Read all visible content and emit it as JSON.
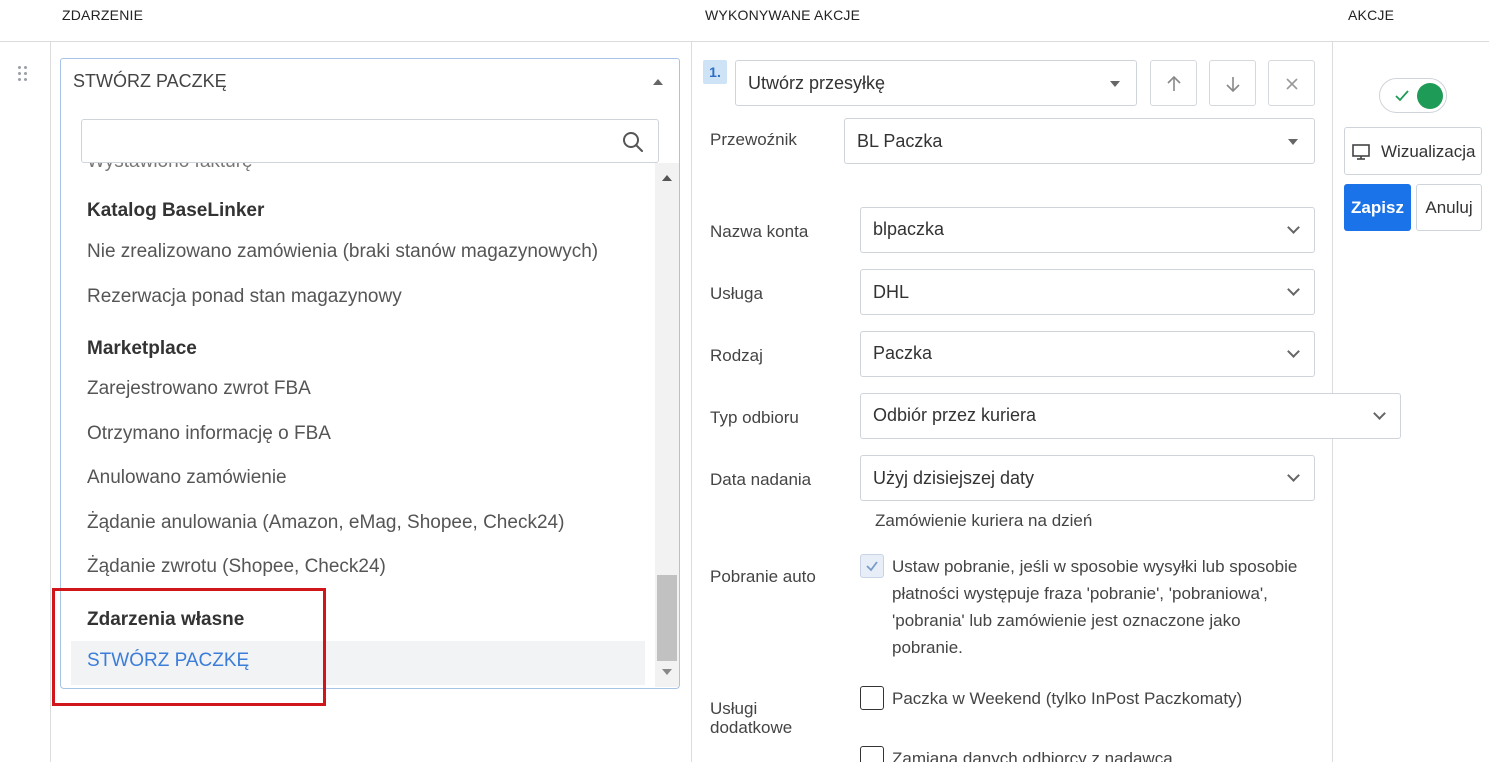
{
  "header": {
    "col_event": "ZDARZENIE",
    "col_actions": "WYKONYWANE AKCJE",
    "col_akcje": "AKCJE"
  },
  "event_select": {
    "value": "STWÓRZ PACZKĘ",
    "search_placeholder": "",
    "cut_item": "Wystawiono fakturę",
    "groups": [
      {
        "label": "Katalog BaseLinker",
        "items": [
          "Nie zrealizowano zamówienia (braki stanów magazynowych)",
          "Rezerwacja ponad stan magazynowy"
        ]
      },
      {
        "label": "Marketplace",
        "items": [
          "Zarejestrowano zwrot FBA",
          "Otrzymano informację o FBA",
          "Anulowano zamówienie",
          "Żądanie anulowania (Amazon, eMag, Shopee, Check24)",
          "Żądanie zwrotu (Shopee, Check24)"
        ]
      },
      {
        "label": "Zdarzenia własne",
        "items": [
          "STWÓRZ PACZKĘ"
        ]
      }
    ]
  },
  "action": {
    "step": "1.",
    "type": "Utwórz przesyłkę",
    "fields": {
      "carrier": {
        "label": "Przewoźnik",
        "value": "BL Paczka"
      },
      "account": {
        "label": "Nazwa konta",
        "value": "blpaczka"
      },
      "service": {
        "label": "Usługa",
        "value": "DHL"
      },
      "kind": {
        "label": "Rodzaj",
        "value": "Paczka"
      },
      "pickup": {
        "label": "Typ odbioru",
        "value": "Odbiór przez kuriera"
      },
      "date": {
        "label": "Data nadania",
        "value": "Użyj dzisiejszej daty",
        "hint": "Zamówienie kuriera na dzień"
      },
      "cod": {
        "label": "Pobranie auto",
        "checked": true,
        "lines": [
          "Ustaw pobranie, jeśli w sposobie wysyłki lub sposobie",
          "płatności występuje fraza 'pobranie', 'pobraniowa',",
          "'pobrania' lub zamówienie jest oznaczone jako",
          "pobranie."
        ]
      },
      "extra": {
        "label_line1": "Usługi",
        "label_line2": "dodatkowe",
        "options": [
          "Paczka w Weekend (tylko InPost Paczkomaty)",
          "Zamiana danych odbiorcy z nadawcą"
        ]
      }
    }
  },
  "right": {
    "toggle_on": true,
    "visualize": "Wizualizacja",
    "save": "Zapisz",
    "cancel": "Anuluj"
  },
  "colors": {
    "accent": "#1a73e8",
    "toggle": "#1e9b57",
    "highlight": "#d0161b",
    "selected_text": "#3b7dd8"
  }
}
